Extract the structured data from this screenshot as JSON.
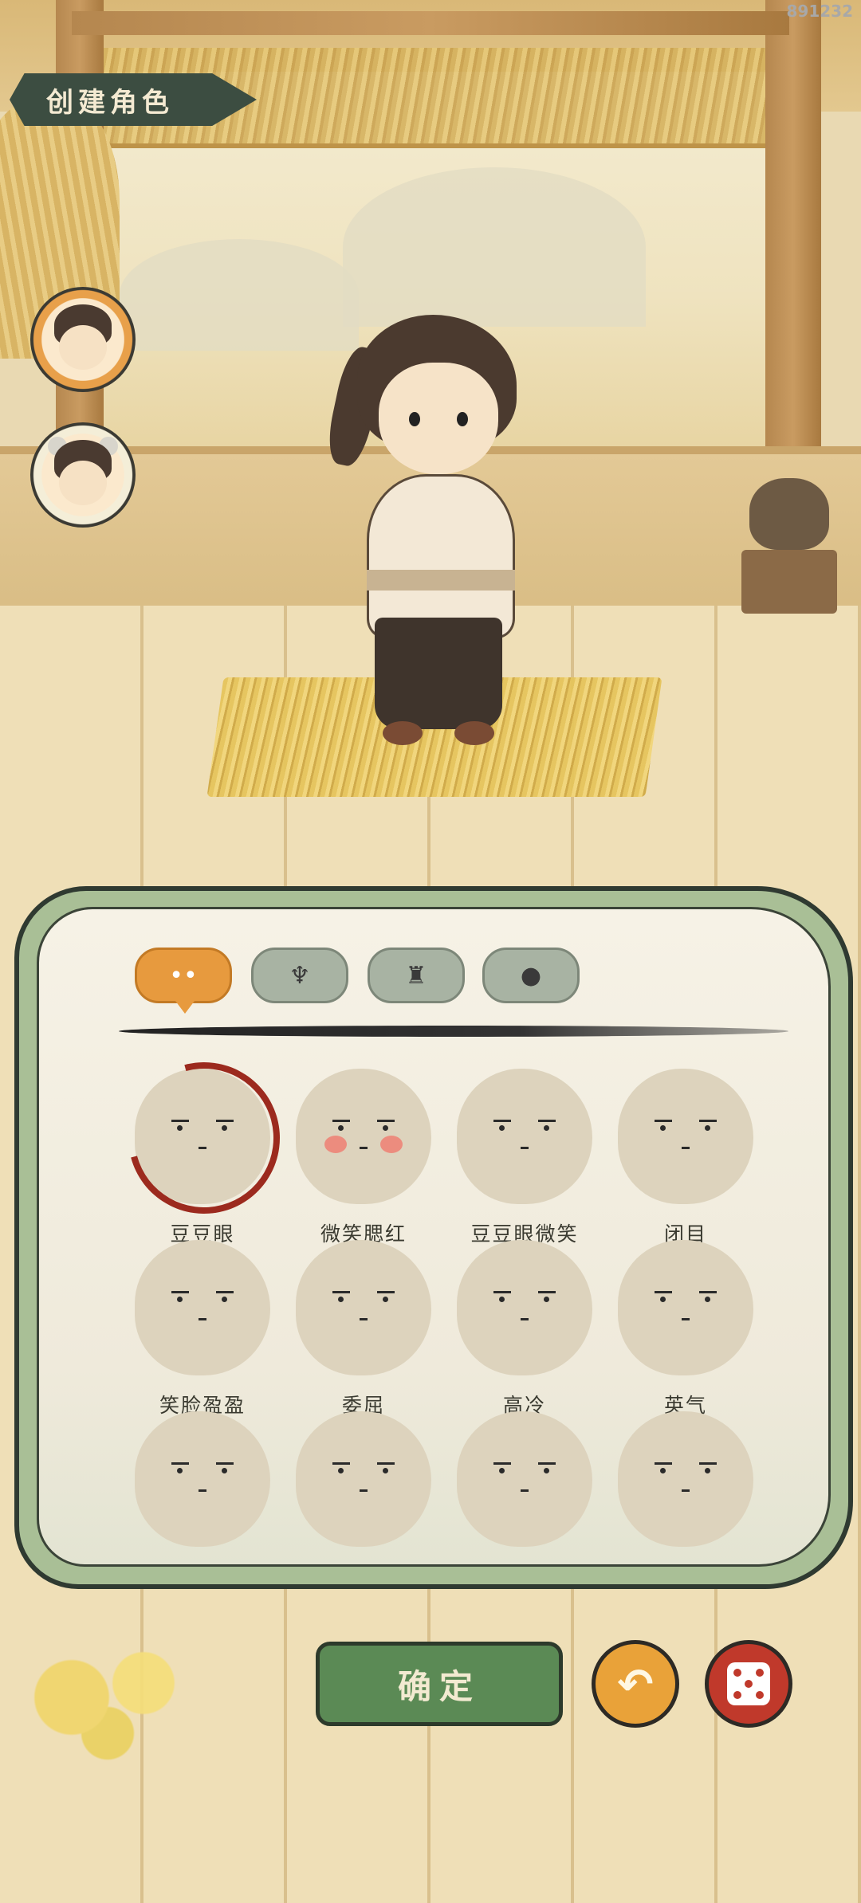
{
  "watermark": "891232",
  "header": {
    "title": "创建角色"
  },
  "character_select": [
    {
      "icon": "male-character-avatar-icon",
      "selected": true
    },
    {
      "icon": "female-character-avatar-icon",
      "selected": false
    }
  ],
  "tabs": [
    {
      "icon": "face-features-icon",
      "glyph": "••",
      "active": true
    },
    {
      "icon": "hairstyle-icon",
      "glyph": "♆",
      "active": false
    },
    {
      "icon": "clothing-icon",
      "glyph": "♜",
      "active": false
    },
    {
      "icon": "head-shape-icon",
      "glyph": "●",
      "active": false
    }
  ],
  "faces": [
    {
      "label": "豆豆眼",
      "selected": true,
      "blush": false
    },
    {
      "label": "微笑腮红",
      "selected": false,
      "blush": true
    },
    {
      "label": "豆豆眼微笑",
      "selected": false,
      "blush": false
    },
    {
      "label": "闭目",
      "selected": false,
      "blush": false
    },
    {
      "label": "笑脸盈盈",
      "selected": false,
      "blush": false
    },
    {
      "label": "委屈",
      "selected": false,
      "blush": false
    },
    {
      "label": "高冷",
      "selected": false,
      "blush": false
    },
    {
      "label": "英气",
      "selected": false,
      "blush": false
    },
    {
      "label": "",
      "selected": false,
      "blush": false
    },
    {
      "label": "",
      "selected": false,
      "blush": false
    },
    {
      "label": "",
      "selected": false,
      "blush": false
    },
    {
      "label": "",
      "selected": false,
      "blush": false
    }
  ],
  "buttons": {
    "confirm": "确定",
    "undo_icon": "undo-icon",
    "undo_glyph": "↶",
    "random_icon": "dice-icon"
  },
  "colors": {
    "accent_orange": "#e79a3e",
    "confirm_green": "#5b8a55",
    "selected_ring": "#9c2a1e",
    "dice_red": "#c0392b"
  }
}
